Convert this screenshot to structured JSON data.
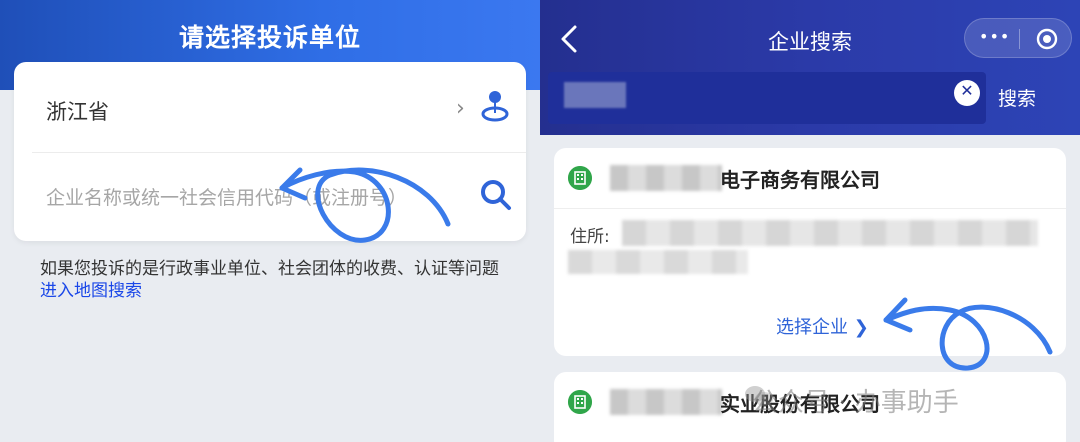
{
  "left": {
    "title_prefix": "请选择",
    "title_highlight": "投诉",
    "title_suffix": "单位",
    "province": "浙江省",
    "search_placeholder": "企业名称或统一社会信用代码（或注册号）",
    "note_text": "如果您投诉的是行政事业单位、社会团体的收费、认证等问题",
    "note_link": "进入地图搜索"
  },
  "right": {
    "title": "企业搜索",
    "capsule_more": "•••",
    "search_button": "搜索",
    "clear_symbol": "✕",
    "results": [
      {
        "name_suffix": "电子商务有限公司",
        "address_label": "住所:",
        "action": "选择企业 ❯"
      },
      {
        "name_suffix": "实业股份有限公司"
      }
    ]
  },
  "watermark": "公众号 · 办事助手",
  "colors": {
    "left_header": "#2f6ee6",
    "right_header": "#2b3aa8",
    "link": "#1a47e8",
    "accent_blue": "#2f64d8",
    "building_green": "#30a64a",
    "annotation": "#3a7bea"
  }
}
